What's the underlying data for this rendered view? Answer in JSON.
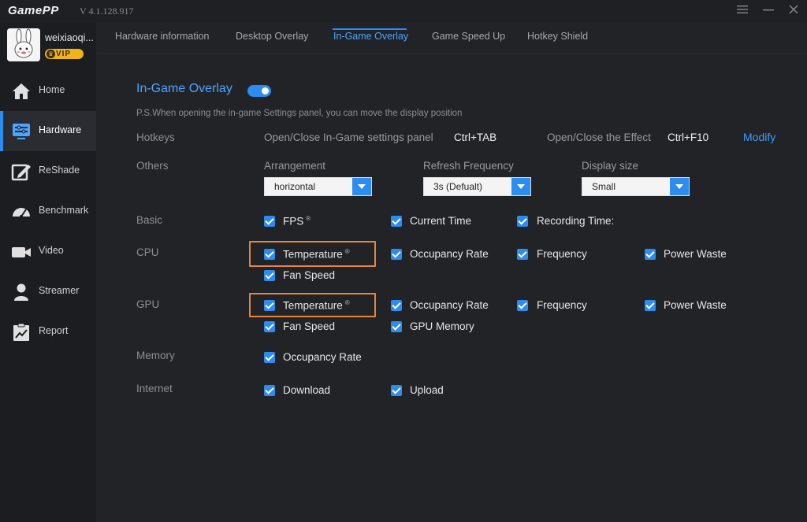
{
  "app": {
    "logo": "GamePP",
    "version": "V 4.1.128.917"
  },
  "user": {
    "name": "weixiaoqi...",
    "badge": "VIP"
  },
  "sidebar": {
    "items": [
      {
        "label": "Home",
        "icon": "home-icon"
      },
      {
        "label": "Hardware",
        "icon": "hardware-icon",
        "active": true
      },
      {
        "label": "ReShade",
        "icon": "reshade-icon"
      },
      {
        "label": "Benchmark",
        "icon": "benchmark-icon"
      },
      {
        "label": "Video",
        "icon": "video-icon"
      },
      {
        "label": "Streamer",
        "icon": "streamer-icon"
      },
      {
        "label": "Report",
        "icon": "report-icon"
      }
    ]
  },
  "tabs": [
    {
      "label": "Hardware information"
    },
    {
      "label": "Desktop Overlay"
    },
    {
      "label": "In-Game Overlay",
      "active": true
    },
    {
      "label": "Game Speed Up"
    },
    {
      "label": "Hotkey Shield"
    }
  ],
  "overlay": {
    "title": "In-Game Overlay",
    "enabled": true,
    "note": "P.S.When opening the in-game Settings panel, you can move the display position",
    "hotkeys": {
      "label": "Hotkeys",
      "settings_panel_label": "Open/Close In-Game settings panel",
      "settings_panel_key": "Ctrl+TAB",
      "effect_label": "Open/Close the Effect",
      "effect_key": "Ctrl+F10",
      "modify_label": "Modify"
    },
    "others": {
      "label": "Others",
      "arrangement_label": "Arrangement",
      "arrangement_value": "horizontal",
      "refresh_label": "Refresh Frequency",
      "refresh_value": "3s  (Defualt)",
      "display_size_label": "Display size",
      "display_size_value": "Small"
    },
    "basic": {
      "label": "Basic",
      "fps": "FPS",
      "fps_mark": "®",
      "current_time": "Current Time",
      "recording_time": "Recording Time:"
    },
    "cpu": {
      "label": "CPU",
      "temperature": "Temperature",
      "temperature_mark": "®",
      "occupancy_rate": "Occupancy Rate",
      "frequency": "Frequency",
      "power_waste": "Power Waste",
      "fan_speed": "Fan Speed"
    },
    "gpu": {
      "label": "GPU",
      "temperature": "Temperature",
      "temperature_mark": "®",
      "occupancy_rate": "Occupancy Rate",
      "frequency": "Frequency",
      "power_waste": "Power Waste",
      "fan_speed": "Fan Speed",
      "gpu_memory": "GPU Memory"
    },
    "memory": {
      "label": "Memory",
      "occupancy_rate": "Occupancy Rate"
    },
    "internet": {
      "label": "Internet",
      "download": "Download",
      "upload": "Upload"
    }
  },
  "colors": {
    "accent": "#2d8cf0",
    "highlight": "#e9853a",
    "vip": "#f0b419"
  }
}
